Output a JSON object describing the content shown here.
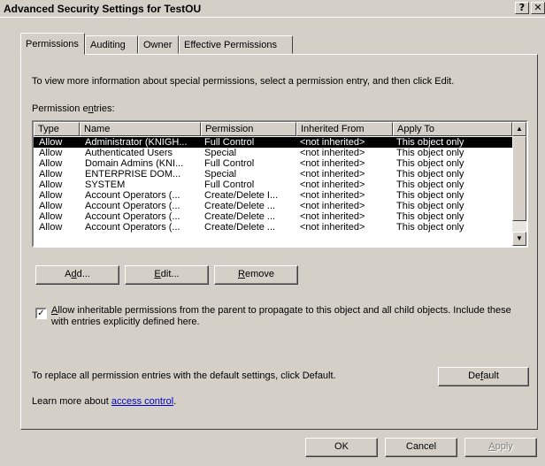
{
  "window": {
    "title": "Advanced Security Settings for TestOU",
    "help_glyph": "?",
    "close_glyph": "✕"
  },
  "tabs": [
    {
      "label": "Permissions",
      "active": true
    },
    {
      "label": "Auditing",
      "active": false
    },
    {
      "label": "Owner",
      "active": false
    },
    {
      "label": "Effective Permissions",
      "active": false
    }
  ],
  "info_text": "To view more information about special permissions, select a permission entry, and then click Edit.",
  "entries_label": {
    "before": "Permission e",
    "accel": "n",
    "after": "tries:"
  },
  "columns": [
    "Type",
    "Name",
    "Permission",
    "Inherited From",
    "Apply To"
  ],
  "rows": [
    {
      "type": "Allow",
      "name": "Administrator (KNIGH...",
      "permission": "Full Control",
      "inherited": "<not inherited>",
      "apply": "This object only",
      "selected": true
    },
    {
      "type": "Allow",
      "name": "Authenticated Users",
      "permission": "Special",
      "inherited": "<not inherited>",
      "apply": "This object only",
      "selected": false
    },
    {
      "type": "Allow",
      "name": "Domain Admins (KNI...",
      "permission": "Full Control",
      "inherited": "<not inherited>",
      "apply": "This object only",
      "selected": false
    },
    {
      "type": "Allow",
      "name": "ENTERPRISE DOM...",
      "permission": "Special",
      "inherited": "<not inherited>",
      "apply": "This object only",
      "selected": false
    },
    {
      "type": "Allow",
      "name": "SYSTEM",
      "permission": "Full Control",
      "inherited": "<not inherited>",
      "apply": "This object only",
      "selected": false
    },
    {
      "type": "Allow",
      "name": "Account Operators (...",
      "permission": "Create/Delete I...",
      "inherited": "<not inherited>",
      "apply": "This object only",
      "selected": false
    },
    {
      "type": "Allow",
      "name": "Account Operators (...",
      "permission": "Create/Delete ...",
      "inherited": "<not inherited>",
      "apply": "This object only",
      "selected": false
    },
    {
      "type": "Allow",
      "name": "Account Operators (...",
      "permission": "Create/Delete ...",
      "inherited": "<not inherited>",
      "apply": "This object only",
      "selected": false
    },
    {
      "type": "Allow",
      "name": "Account Operators (...",
      "permission": "Create/Delete ...",
      "inherited": "<not inherited>",
      "apply": "This object only",
      "selected": false
    }
  ],
  "scroll": {
    "up_glyph": "▲",
    "down_glyph": "▼"
  },
  "buttons": {
    "add": {
      "before": "A",
      "accel": "d",
      "after": "d..."
    },
    "edit": {
      "before": "",
      "accel": "E",
      "after": "dit..."
    },
    "remove": {
      "before": "",
      "accel": "R",
      "after": "emove"
    },
    "default": {
      "before": "De",
      "accel": "f",
      "after": "ault"
    },
    "ok": "OK",
    "cancel": "Cancel",
    "apply": {
      "before": "",
      "accel": "A",
      "after": "pply"
    }
  },
  "inherit_checkbox": {
    "checked": true,
    "check_glyph": "✓",
    "accel": "A",
    "label_rest": "llow inheritable permissions from the parent to propagate to this object and all child objects. Include these with entries explicitly defined here."
  },
  "default_text": "To replace all permission entries with the default settings, click Default.",
  "learn": {
    "prefix": "Learn more about ",
    "link": "access control",
    "suffix": "."
  }
}
